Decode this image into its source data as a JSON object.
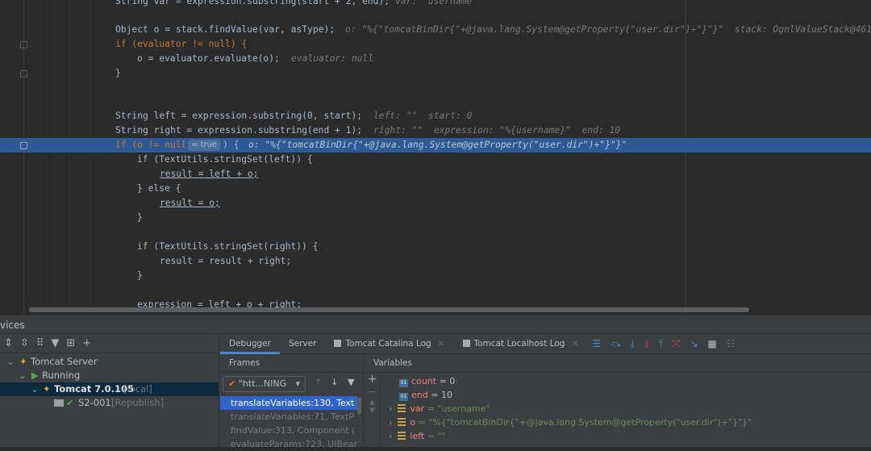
{
  "editor": {
    "lines": {
      "l1": {
        "code": "String var = expression.substring(start + 2, end);",
        "hint": "var: \"username\""
      },
      "l2": {
        "code": "Object o = stack.findValue(var, asType);",
        "hint": "o: \"%{\"tomcatBinDir{\"+@java.lang.System@getProperty(\"user.dir\")+\"}\"}\"  stack: OgnlValueStack@461"
      },
      "l3": {
        "code": "if (evaluator != null) {"
      },
      "l4": {
        "code": "o = evaluator.evaluate(o);",
        "hint": "evaluator: null"
      },
      "l5": {
        "code": "}"
      },
      "l6": {
        "code": "String left = expression.substring(0, start);",
        "hint": "left: \"\"  start: 0"
      },
      "l7": {
        "code": "String right = expression.substring(end + 1);",
        "hint": "right: \"\"  expression: \"%{username}\"  end: 10"
      },
      "l8": {
        "code": "if (o != null",
        "inline": "= true",
        "code2": ") {",
        "hint": "o: \"%{\"tomcatBinDir{\"+@java.lang.System@getProperty(\"user.dir\")+\"}\"}\""
      },
      "l9": {
        "code": "if (TextUtils.stringSet(left)) {"
      },
      "l10": {
        "code": "result = left + o;"
      },
      "l11": {
        "code": "} else {"
      },
      "l12": {
        "code": "result = o;"
      },
      "l13": {
        "code": "}"
      },
      "l14": {
        "code": "if (TextUtils.stringSet(right)) {"
      },
      "l15": {
        "code": "result = result + right;"
      },
      "l16": {
        "code": "}"
      },
      "l17": {
        "code": "expression = left + o + right;"
      }
    }
  },
  "services": {
    "title": "vices",
    "tree": [
      {
        "label": "Tomcat Server"
      },
      {
        "label": "Running"
      },
      {
        "label": "Tomcat 7.0.105",
        "tag": "[local]"
      },
      {
        "label": "S2-001",
        "tag": "[Republish]"
      }
    ]
  },
  "tabs": [
    "Debugger",
    "Server",
    "Tomcat Catalina Log",
    "Tomcat Localhost Log"
  ],
  "frames": {
    "header": "Frames",
    "thread": "\"htt...NING",
    "items": [
      "translateVariables:130, Text",
      "translateVariables:71, TextP",
      "findValue:313, Component (",
      "evaluateParams:723, UIBear"
    ]
  },
  "variables": {
    "header": "Variables",
    "items": [
      {
        "name": "count",
        "value": "= 0"
      },
      {
        "name": "end",
        "value": "= 10"
      },
      {
        "name": "var",
        "value": "= \"username\""
      },
      {
        "name": "o",
        "value": "= \"%{\"tomcatBinDir{\"+@java.lang.System@getProperty(\"user.dir\")+\"}\"}\""
      },
      {
        "name": "left",
        "value": "= \"\""
      }
    ]
  }
}
